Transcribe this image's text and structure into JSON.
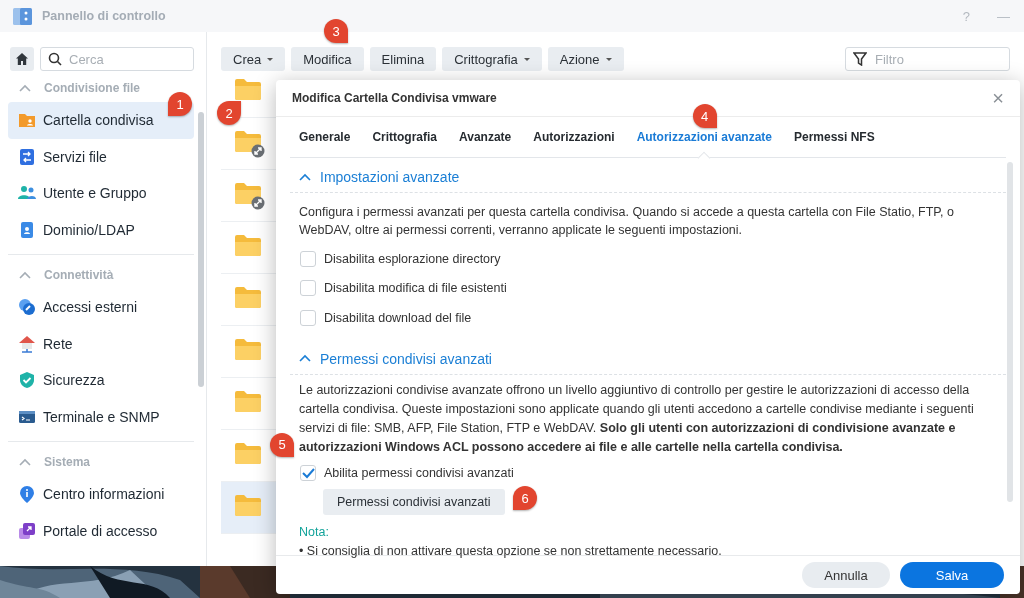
{
  "window": {
    "title": "Pannello di controllo",
    "help": "?",
    "minimize": "—"
  },
  "sidebar": {
    "search": {
      "placeholder": "Cerca"
    },
    "sections": [
      {
        "title": "Condivisione file",
        "expanded": true,
        "items": [
          {
            "label": "Cartella condivisa",
            "selected": true,
            "callout": "1"
          },
          {
            "label": "Servizi file",
            "selected": false
          },
          {
            "label": "Utente e Gruppo",
            "selected": false
          },
          {
            "label": "Dominio/LDAP",
            "selected": false
          }
        ]
      },
      {
        "title": "Connettività",
        "expanded": true,
        "items": [
          {
            "label": "Accessi esterni",
            "selected": false
          },
          {
            "label": "Rete",
            "selected": false
          },
          {
            "label": "Sicurezza",
            "selected": false
          },
          {
            "label": "Terminale e SNMP",
            "selected": false
          }
        ]
      },
      {
        "title": "Sistema",
        "expanded": true,
        "items": [
          {
            "label": "Centro informazioni",
            "selected": false
          },
          {
            "label": "Portale di accesso",
            "selected": false
          }
        ]
      }
    ]
  },
  "toolbar": {
    "buttons": [
      {
        "label": "Crea",
        "dropdown": true
      },
      {
        "label": "Modifica",
        "dropdown": false,
        "callout": "3"
      },
      {
        "label": "Elimina",
        "dropdown": false
      },
      {
        "label": "Crittografia",
        "dropdown": true
      },
      {
        "label": "Azione",
        "dropdown": true
      }
    ],
    "filter": {
      "placeholder": "Filtro"
    }
  },
  "folders": [
    {
      "linked": false,
      "selected": false,
      "callout": "2"
    },
    {
      "linked": true,
      "selected": false
    },
    {
      "linked": true,
      "selected": false
    },
    {
      "linked": false,
      "selected": false
    },
    {
      "linked": false,
      "selected": false
    },
    {
      "linked": false,
      "selected": false
    },
    {
      "linked": false,
      "selected": false
    },
    {
      "linked": false,
      "selected": false
    },
    {
      "linked": false,
      "selected": true
    }
  ],
  "dialog": {
    "title": "Modifica Cartella Condivisa vmware",
    "close": "×",
    "tabs": [
      {
        "label": "Generale",
        "selected": false
      },
      {
        "label": "Crittografia",
        "selected": false
      },
      {
        "label": "Avanzate",
        "selected": false
      },
      {
        "label": "Autorizzazioni",
        "selected": false
      },
      {
        "label": "Autorizzazioni avanzate",
        "selected": true,
        "callout": "4"
      },
      {
        "label": "Permessi NFS",
        "selected": false
      }
    ],
    "sections": [
      {
        "title": "Impostazioni avanzate",
        "expanded": true,
        "description": "Configura i permessi avanzati per questa cartella condivisa. Quando si accede a questa cartella con File Statio, FTP, o WebDAV, oltre ai permessi correnti, verranno applicate le seguenti impostazioni.",
        "options": [
          {
            "label": "Disabilita esplorazione directory",
            "checked": false
          },
          {
            "label": "Disabilita modifica di file esistenti",
            "checked": false
          },
          {
            "label": "Disabilita download del file",
            "checked": false
          }
        ]
      },
      {
        "title": "Permessi condivisi avanzati",
        "expanded": true,
        "description": "Le autorizzazioni condivise avanzate offrono un livello aggiuntivo di controllo per gestire le autorizzazioni di accesso della cartella condivisa. Queste impostazioni sono applicate quando gli utenti accedono a cartelle condivise mediante i seguenti servizi di file: SMB, AFP, File Station, FTP e WebDAV. **Solo gli utenti con autorizzazioni di condivisione avanzate e autorizzazioni Windows ACL possono accedere ai file e alle cartelle nella cartella condivisa.**",
        "options": [
          {
            "label": "Abilita permessi condivisi avanzati",
            "checked": true,
            "callout": "5"
          }
        ],
        "button": {
          "label": "Permessi condivisi avanzati",
          "callout": "6"
        },
        "note": {
          "title": "Nota:",
          "bullets": [
            "• Si consiglia di non attivare questa opzione se non strettamente necessario."
          ]
        }
      }
    ],
    "buttons": [
      {
        "label": "Annulla",
        "kind": "secondary"
      },
      {
        "label": "Salva",
        "kind": "primary"
      }
    ]
  }
}
